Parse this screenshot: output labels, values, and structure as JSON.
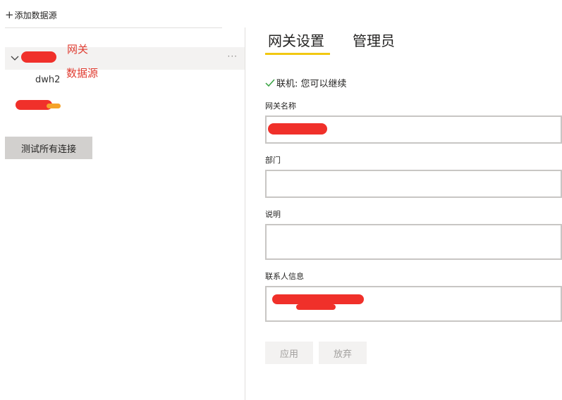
{
  "left_panel": {
    "add_data_source": "添加数据源",
    "datasource_name": "dwh2",
    "test_all_button": "测试所有连接",
    "more_options": "···"
  },
  "annotations": {
    "gateway_label": "网关",
    "datasource_label": "数据源"
  },
  "tabs": [
    {
      "label": "网关设置",
      "active": true
    },
    {
      "label": "管理员",
      "active": false
    }
  ],
  "status": {
    "text": "联机: 您可以继续"
  },
  "form": {
    "gateway_name_label": "网关名称",
    "department_label": "部门",
    "description_label": "说明",
    "contact_label": "联系人信息",
    "department_value": "",
    "description_value": ""
  },
  "buttons": {
    "apply": "应用",
    "discard": "放弃"
  },
  "colors": {
    "accent": "#f2c811",
    "status_check": "#37a341",
    "annotation": "#e03c31",
    "redaction": "#f0302a"
  },
  "icons": [
    "plus-icon",
    "chevron-down-icon",
    "more-icon",
    "check-icon"
  ]
}
